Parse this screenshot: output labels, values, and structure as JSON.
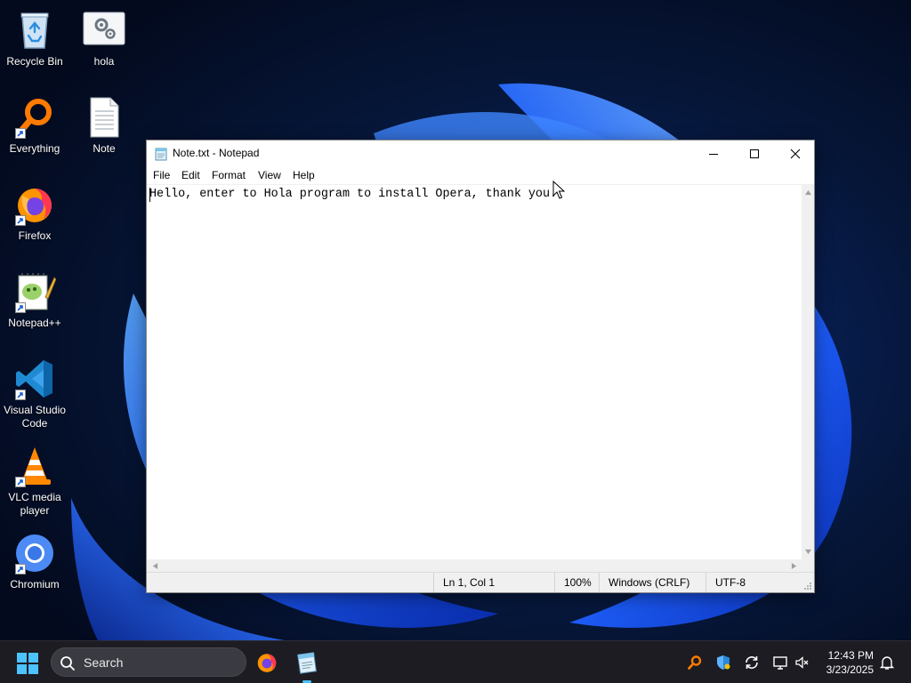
{
  "desktop": {
    "icons": [
      {
        "label": "Recycle Bin",
        "icon": "recycle-bin-icon"
      },
      {
        "label": "hola",
        "icon": "settings-file-icon"
      },
      {
        "label": "Everything",
        "icon": "everything-search-icon"
      },
      {
        "label": "Note",
        "icon": "text-file-icon"
      },
      {
        "label": "Firefox",
        "icon": "firefox-icon"
      },
      {
        "label": "Notepad++",
        "icon": "notepad-plus-plus-icon"
      },
      {
        "label": "Visual Studio Code",
        "icon": "vscode-icon"
      },
      {
        "label": "VLC media player",
        "icon": "vlc-icon"
      },
      {
        "label": "Chromium",
        "icon": "chromium-icon"
      }
    ]
  },
  "notepad": {
    "title": "Note.txt - Notepad",
    "menu": [
      "File",
      "Edit",
      "Format",
      "View",
      "Help"
    ],
    "content": "Hello, enter to Hola program to install Opera, thank you.",
    "status": {
      "position": "Ln 1, Col 1",
      "zoom": "100%",
      "line_ending": "Windows (CRLF)",
      "encoding": "UTF-8"
    }
  },
  "taskbar": {
    "search_placeholder": "Search",
    "pinned": [
      "firefox-icon",
      "notepad-icon"
    ],
    "tray": [
      "everything-tray-icon",
      "defender-shield-icon",
      "sync-icon",
      "network-display-icon",
      "speaker-muted-icon"
    ],
    "time": "12:43 PM",
    "date": "3/23/2025"
  },
  "colors": {
    "taskbar_bg": "#1c1c22",
    "wallpaper_dark": "#05112e",
    "wallpaper_blue": "#1e5fff",
    "accent": "#4cc2ff"
  }
}
